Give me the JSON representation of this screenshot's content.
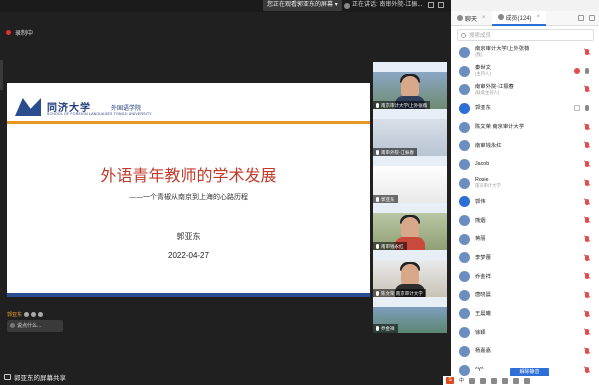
{
  "topbar": {
    "viewing_text": "您正在观看郭亚东的屏幕",
    "viewing_menu_glyph": "▾",
    "speaking_text": "正在讲话: 南审外院-江振..."
  },
  "recording": {
    "label": "录制中"
  },
  "slide": {
    "school_cn": "同济大学",
    "school_cn2": "外国语学院",
    "school_en": "SCHOOL OF FOREIGN LANGUAGES TONGJI UNIVERSITY",
    "title": "外语青年教师的学术发展",
    "subtitle": "——一个青椒从南京到上海的心路历程",
    "author": "郭亚东",
    "date": "2022-04-27"
  },
  "chat_overlay": {
    "user": "郭亚东",
    "message": "说点什么..."
  },
  "share_status": "郭亚东的屏幕共享",
  "tiles": [
    {
      "label": "南京审计大学/上外张薇"
    },
    {
      "label": "南审外院-江振春"
    },
    {
      "label": "郭亚东"
    },
    {
      "label": "南审钱永红"
    },
    {
      "label": "陈文荣 南京审计大学"
    },
    {
      "label": "乔金祥"
    }
  ],
  "panel": {
    "tab_chat": "聊天",
    "tab_members": "成员(124)",
    "tab_close": "×",
    "search_placeholder": "搜索成员",
    "members": [
      {
        "name": "南京审计大学/上外张薇",
        "sub": "(我)"
      },
      {
        "name": "秦世文",
        "sub": "(主持人)"
      },
      {
        "name": "南审外院-江振春",
        "sub": "(联席主持人)"
      },
      {
        "name": "郭亚东",
        "sub": ""
      },
      {
        "name": "陈文荣 南京审计大学",
        "sub": ""
      },
      {
        "name": "南审钱永红",
        "sub": ""
      },
      {
        "name": "Jacob",
        "sub": ""
      },
      {
        "name": "Rosie",
        "sub": "南京审计大学"
      },
      {
        "name": "郭伟",
        "sub": ""
      },
      {
        "name": "熊烟",
        "sub": ""
      },
      {
        "name": "蒋丽",
        "sub": ""
      },
      {
        "name": "李梦蕾",
        "sub": ""
      },
      {
        "name": "乔金祥",
        "sub": ""
      },
      {
        "name": "唐晓晨",
        "sub": ""
      },
      {
        "name": "王晨曦",
        "sub": ""
      },
      {
        "name": "徐颖",
        "sub": ""
      },
      {
        "name": "杨嘉嘉",
        "sub": ""
      },
      {
        "name": "^Y^",
        "sub": ""
      }
    ],
    "unmute_all": "解除静音"
  },
  "taskbar": {
    "ime": "S",
    "ime_mode": "中"
  },
  "colors": {
    "accent": "#2d6fd6",
    "slide_title": "#c0392b",
    "slide_bar": "#e69822",
    "recording": "#e03030"
  }
}
